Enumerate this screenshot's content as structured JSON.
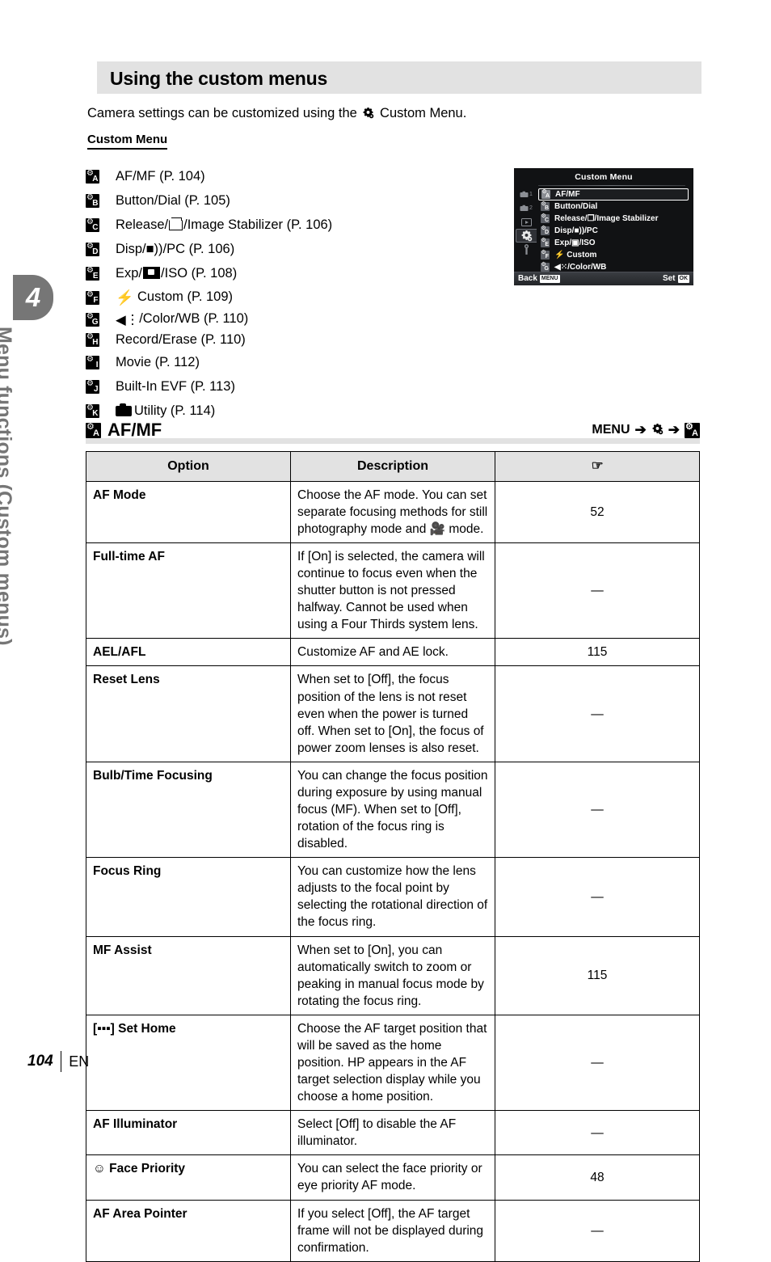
{
  "chapter": {
    "number": "4",
    "vertical_title": "Menu functions (Custom menus)"
  },
  "header": {
    "title": "Using the custom menus"
  },
  "intro": {
    "before_icon": "Camera settings can be customized using the",
    "icon": "gear-icon",
    "after_icon": "Custom Menu."
  },
  "submenu_heading": "Custom Menu",
  "menu_list": [
    {
      "badge_letter": "A",
      "label": "AF/MF (P. 104)"
    },
    {
      "badge_letter": "B",
      "label": "Button/Dial (P. 105)"
    },
    {
      "badge_letter": "C",
      "label_pre": "Release/",
      "icon": "sequential-shooting-icon",
      "label_post": "/Image Stabilizer (P. 106)"
    },
    {
      "badge_letter": "D",
      "label": "Disp/■))/PC (P. 106)"
    },
    {
      "badge_letter": "E",
      "label_pre": "Exp/",
      "icon": "metering-icon",
      "label_post": "/ISO (P. 108)"
    },
    {
      "badge_letter": "F",
      "label_pre": "",
      "icon": "flash-bolt-icon",
      "label_post": "Custom (P. 109)"
    },
    {
      "badge_letter": "G",
      "label_pre": "",
      "icon": "image-quality-icon",
      "label_post": "/Color/WB (P. 110)"
    },
    {
      "badge_letter": "H",
      "label": "Record/Erase (P. 110)"
    },
    {
      "badge_letter": "I",
      "label": "Movie (P. 112)"
    },
    {
      "badge_letter": "J",
      "label": "Built-In EVF (P. 113)"
    },
    {
      "badge_letter": "K",
      "label_pre": "",
      "icon": "camera-icon",
      "label_post": "Utility (P. 114)"
    }
  ],
  "lcd": {
    "title": "Custom Menu",
    "sidebar": [
      {
        "icon": "camera1-icon",
        "label": "1"
      },
      {
        "icon": "camera2-icon",
        "label": "2"
      },
      {
        "icon": "playback-icon",
        "label": ""
      },
      {
        "icon": "gear-icon",
        "label": "",
        "active": true
      },
      {
        "icon": "wrench-icon",
        "label": ""
      }
    ],
    "items": [
      {
        "badge_letter": "A",
        "text": "AF/MF",
        "selected": true
      },
      {
        "badge_letter": "B",
        "text": "Button/Dial",
        "selected": false
      },
      {
        "badge_letter": "C",
        "text": "Release/❐/Image Stabilizer",
        "selected": false
      },
      {
        "badge_letter": "D",
        "text": "Disp/■))/PC",
        "selected": false
      },
      {
        "badge_letter": "E",
        "text": "Exp/▣/ISO",
        "selected": false
      },
      {
        "badge_letter": "F",
        "text": "⚡ Custom",
        "selected": false
      },
      {
        "badge_letter": "G",
        "text": "◀⁙/Color/WB",
        "selected": false
      }
    ],
    "bottom": {
      "back_label": "Back",
      "back_key": "MENU",
      "set_label": "Set",
      "set_key": "OK"
    }
  },
  "section": {
    "badge_letter": "A",
    "title": "AF/MF",
    "breadcrumb": {
      "menu": "MENU",
      "arrow": "➔",
      "gear_icon": "gear-icon",
      "target_badge": "A"
    }
  },
  "table": {
    "headers": {
      "option": "Option",
      "description": "Description",
      "reference": "☞"
    },
    "rows": [
      {
        "option": "AF Mode",
        "option_icon": "",
        "description": "Choose the AF mode. You can set separate focusing methods for still photography mode and 🎥 mode.",
        "reference": "52"
      },
      {
        "option": "Full-time AF",
        "option_icon": "",
        "description": "If [On] is selected, the camera will continue to focus even when the shutter button is not pressed halfway. Cannot be used when using a Four Thirds system lens.",
        "reference": "—"
      },
      {
        "option": "AEL/AFL",
        "option_icon": "",
        "description": "Customize AF and AE lock.",
        "reference": "115"
      },
      {
        "option": "Reset Lens",
        "option_icon": "",
        "description": "When set to [Off], the focus position of the lens is not reset even when the power is turned off. When set to [On], the focus of power zoom lenses is also reset.",
        "reference": "—"
      },
      {
        "option": "Bulb/Time Focusing",
        "option_icon": "",
        "description": "You can change the focus position during exposure by using manual focus (MF). When set to [Off], rotation of the focus ring is disabled.",
        "reference": "—"
      },
      {
        "option": "Focus Ring",
        "option_icon": "",
        "description": "You can customize how the lens adjusts to the focal point by selecting the rotational direction of the focus ring.",
        "reference": "—"
      },
      {
        "option": "MF Assist",
        "option_icon": "",
        "description": "When set to [On], you can automatically switch to zoom or peaking in manual focus mode by rotating the focus ring.",
        "reference": "115"
      },
      {
        "option": "Set Home",
        "option_icon": "af-target-icon",
        "description": "Choose the AF target position that will be saved as the home position. HP appears in the AF target selection display while you choose a home position.",
        "reference": "—"
      },
      {
        "option": "AF Illuminator",
        "option_icon": "",
        "description": "Select [Off] to disable the AF illuminator.",
        "reference": "—"
      },
      {
        "option": "Face Priority",
        "option_icon": "face-icon",
        "description": "You can select the face priority or eye priority AF mode.",
        "reference": "48"
      },
      {
        "option": "AF Area Pointer",
        "option_icon": "",
        "description": "If you select [Off], the AF target frame will not be displayed during confirmation.",
        "reference": "—"
      }
    ]
  },
  "footer": {
    "page_number": "104",
    "language": "EN"
  },
  "colors": {
    "band_gray": "#e2e2e2",
    "chapter_gray": "#767676",
    "lcd_bg": "#111214",
    "text": "#000000"
  }
}
